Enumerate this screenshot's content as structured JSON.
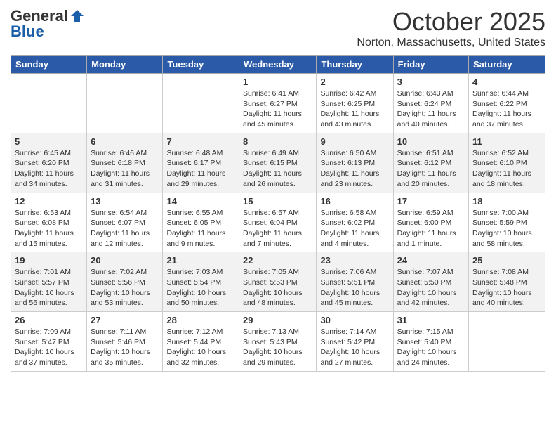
{
  "header": {
    "logo_general": "General",
    "logo_blue": "Blue",
    "month": "October 2025",
    "location": "Norton, Massachusetts, United States"
  },
  "weekdays": [
    "Sunday",
    "Monday",
    "Tuesday",
    "Wednesday",
    "Thursday",
    "Friday",
    "Saturday"
  ],
  "weeks": [
    [
      {
        "day": "",
        "info": ""
      },
      {
        "day": "",
        "info": ""
      },
      {
        "day": "",
        "info": ""
      },
      {
        "day": "1",
        "info": "Sunrise: 6:41 AM\nSunset: 6:27 PM\nDaylight: 11 hours\nand 45 minutes."
      },
      {
        "day": "2",
        "info": "Sunrise: 6:42 AM\nSunset: 6:25 PM\nDaylight: 11 hours\nand 43 minutes."
      },
      {
        "day": "3",
        "info": "Sunrise: 6:43 AM\nSunset: 6:24 PM\nDaylight: 11 hours\nand 40 minutes."
      },
      {
        "day": "4",
        "info": "Sunrise: 6:44 AM\nSunset: 6:22 PM\nDaylight: 11 hours\nand 37 minutes."
      }
    ],
    [
      {
        "day": "5",
        "info": "Sunrise: 6:45 AM\nSunset: 6:20 PM\nDaylight: 11 hours\nand 34 minutes."
      },
      {
        "day": "6",
        "info": "Sunrise: 6:46 AM\nSunset: 6:18 PM\nDaylight: 11 hours\nand 31 minutes."
      },
      {
        "day": "7",
        "info": "Sunrise: 6:48 AM\nSunset: 6:17 PM\nDaylight: 11 hours\nand 29 minutes."
      },
      {
        "day": "8",
        "info": "Sunrise: 6:49 AM\nSunset: 6:15 PM\nDaylight: 11 hours\nand 26 minutes."
      },
      {
        "day": "9",
        "info": "Sunrise: 6:50 AM\nSunset: 6:13 PM\nDaylight: 11 hours\nand 23 minutes."
      },
      {
        "day": "10",
        "info": "Sunrise: 6:51 AM\nSunset: 6:12 PM\nDaylight: 11 hours\nand 20 minutes."
      },
      {
        "day": "11",
        "info": "Sunrise: 6:52 AM\nSunset: 6:10 PM\nDaylight: 11 hours\nand 18 minutes."
      }
    ],
    [
      {
        "day": "12",
        "info": "Sunrise: 6:53 AM\nSunset: 6:08 PM\nDaylight: 11 hours\nand 15 minutes."
      },
      {
        "day": "13",
        "info": "Sunrise: 6:54 AM\nSunset: 6:07 PM\nDaylight: 11 hours\nand 12 minutes."
      },
      {
        "day": "14",
        "info": "Sunrise: 6:55 AM\nSunset: 6:05 PM\nDaylight: 11 hours\nand 9 minutes."
      },
      {
        "day": "15",
        "info": "Sunrise: 6:57 AM\nSunset: 6:04 PM\nDaylight: 11 hours\nand 7 minutes."
      },
      {
        "day": "16",
        "info": "Sunrise: 6:58 AM\nSunset: 6:02 PM\nDaylight: 11 hours\nand 4 minutes."
      },
      {
        "day": "17",
        "info": "Sunrise: 6:59 AM\nSunset: 6:00 PM\nDaylight: 11 hours\nand 1 minute."
      },
      {
        "day": "18",
        "info": "Sunrise: 7:00 AM\nSunset: 5:59 PM\nDaylight: 10 hours\nand 58 minutes."
      }
    ],
    [
      {
        "day": "19",
        "info": "Sunrise: 7:01 AM\nSunset: 5:57 PM\nDaylight: 10 hours\nand 56 minutes."
      },
      {
        "day": "20",
        "info": "Sunrise: 7:02 AM\nSunset: 5:56 PM\nDaylight: 10 hours\nand 53 minutes."
      },
      {
        "day": "21",
        "info": "Sunrise: 7:03 AM\nSunset: 5:54 PM\nDaylight: 10 hours\nand 50 minutes."
      },
      {
        "day": "22",
        "info": "Sunrise: 7:05 AM\nSunset: 5:53 PM\nDaylight: 10 hours\nand 48 minutes."
      },
      {
        "day": "23",
        "info": "Sunrise: 7:06 AM\nSunset: 5:51 PM\nDaylight: 10 hours\nand 45 minutes."
      },
      {
        "day": "24",
        "info": "Sunrise: 7:07 AM\nSunset: 5:50 PM\nDaylight: 10 hours\nand 42 minutes."
      },
      {
        "day": "25",
        "info": "Sunrise: 7:08 AM\nSunset: 5:48 PM\nDaylight: 10 hours\nand 40 minutes."
      }
    ],
    [
      {
        "day": "26",
        "info": "Sunrise: 7:09 AM\nSunset: 5:47 PM\nDaylight: 10 hours\nand 37 minutes."
      },
      {
        "day": "27",
        "info": "Sunrise: 7:11 AM\nSunset: 5:46 PM\nDaylight: 10 hours\nand 35 minutes."
      },
      {
        "day": "28",
        "info": "Sunrise: 7:12 AM\nSunset: 5:44 PM\nDaylight: 10 hours\nand 32 minutes."
      },
      {
        "day": "29",
        "info": "Sunrise: 7:13 AM\nSunset: 5:43 PM\nDaylight: 10 hours\nand 29 minutes."
      },
      {
        "day": "30",
        "info": "Sunrise: 7:14 AM\nSunset: 5:42 PM\nDaylight: 10 hours\nand 27 minutes."
      },
      {
        "day": "31",
        "info": "Sunrise: 7:15 AM\nSunset: 5:40 PM\nDaylight: 10 hours\nand 24 minutes."
      },
      {
        "day": "",
        "info": ""
      }
    ]
  ]
}
